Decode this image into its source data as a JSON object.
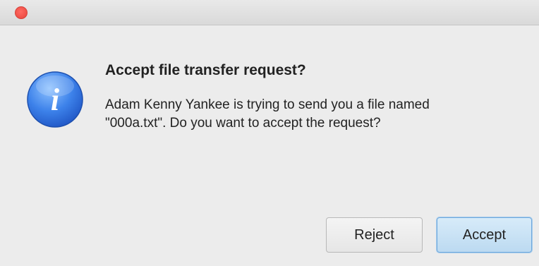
{
  "dialog": {
    "title": "Accept file transfer request?",
    "message": "Adam Kenny Yankee is trying to send you a file named \"000a.txt\". Do you want to accept the request?",
    "icon": "info-icon",
    "icon_glyph": "i"
  },
  "buttons": {
    "reject_label": "Reject",
    "accept_label": "Accept"
  },
  "colors": {
    "close": "#ec4a41",
    "icon_blue": "#2f6fe0",
    "accent": "#6fa8dc"
  }
}
